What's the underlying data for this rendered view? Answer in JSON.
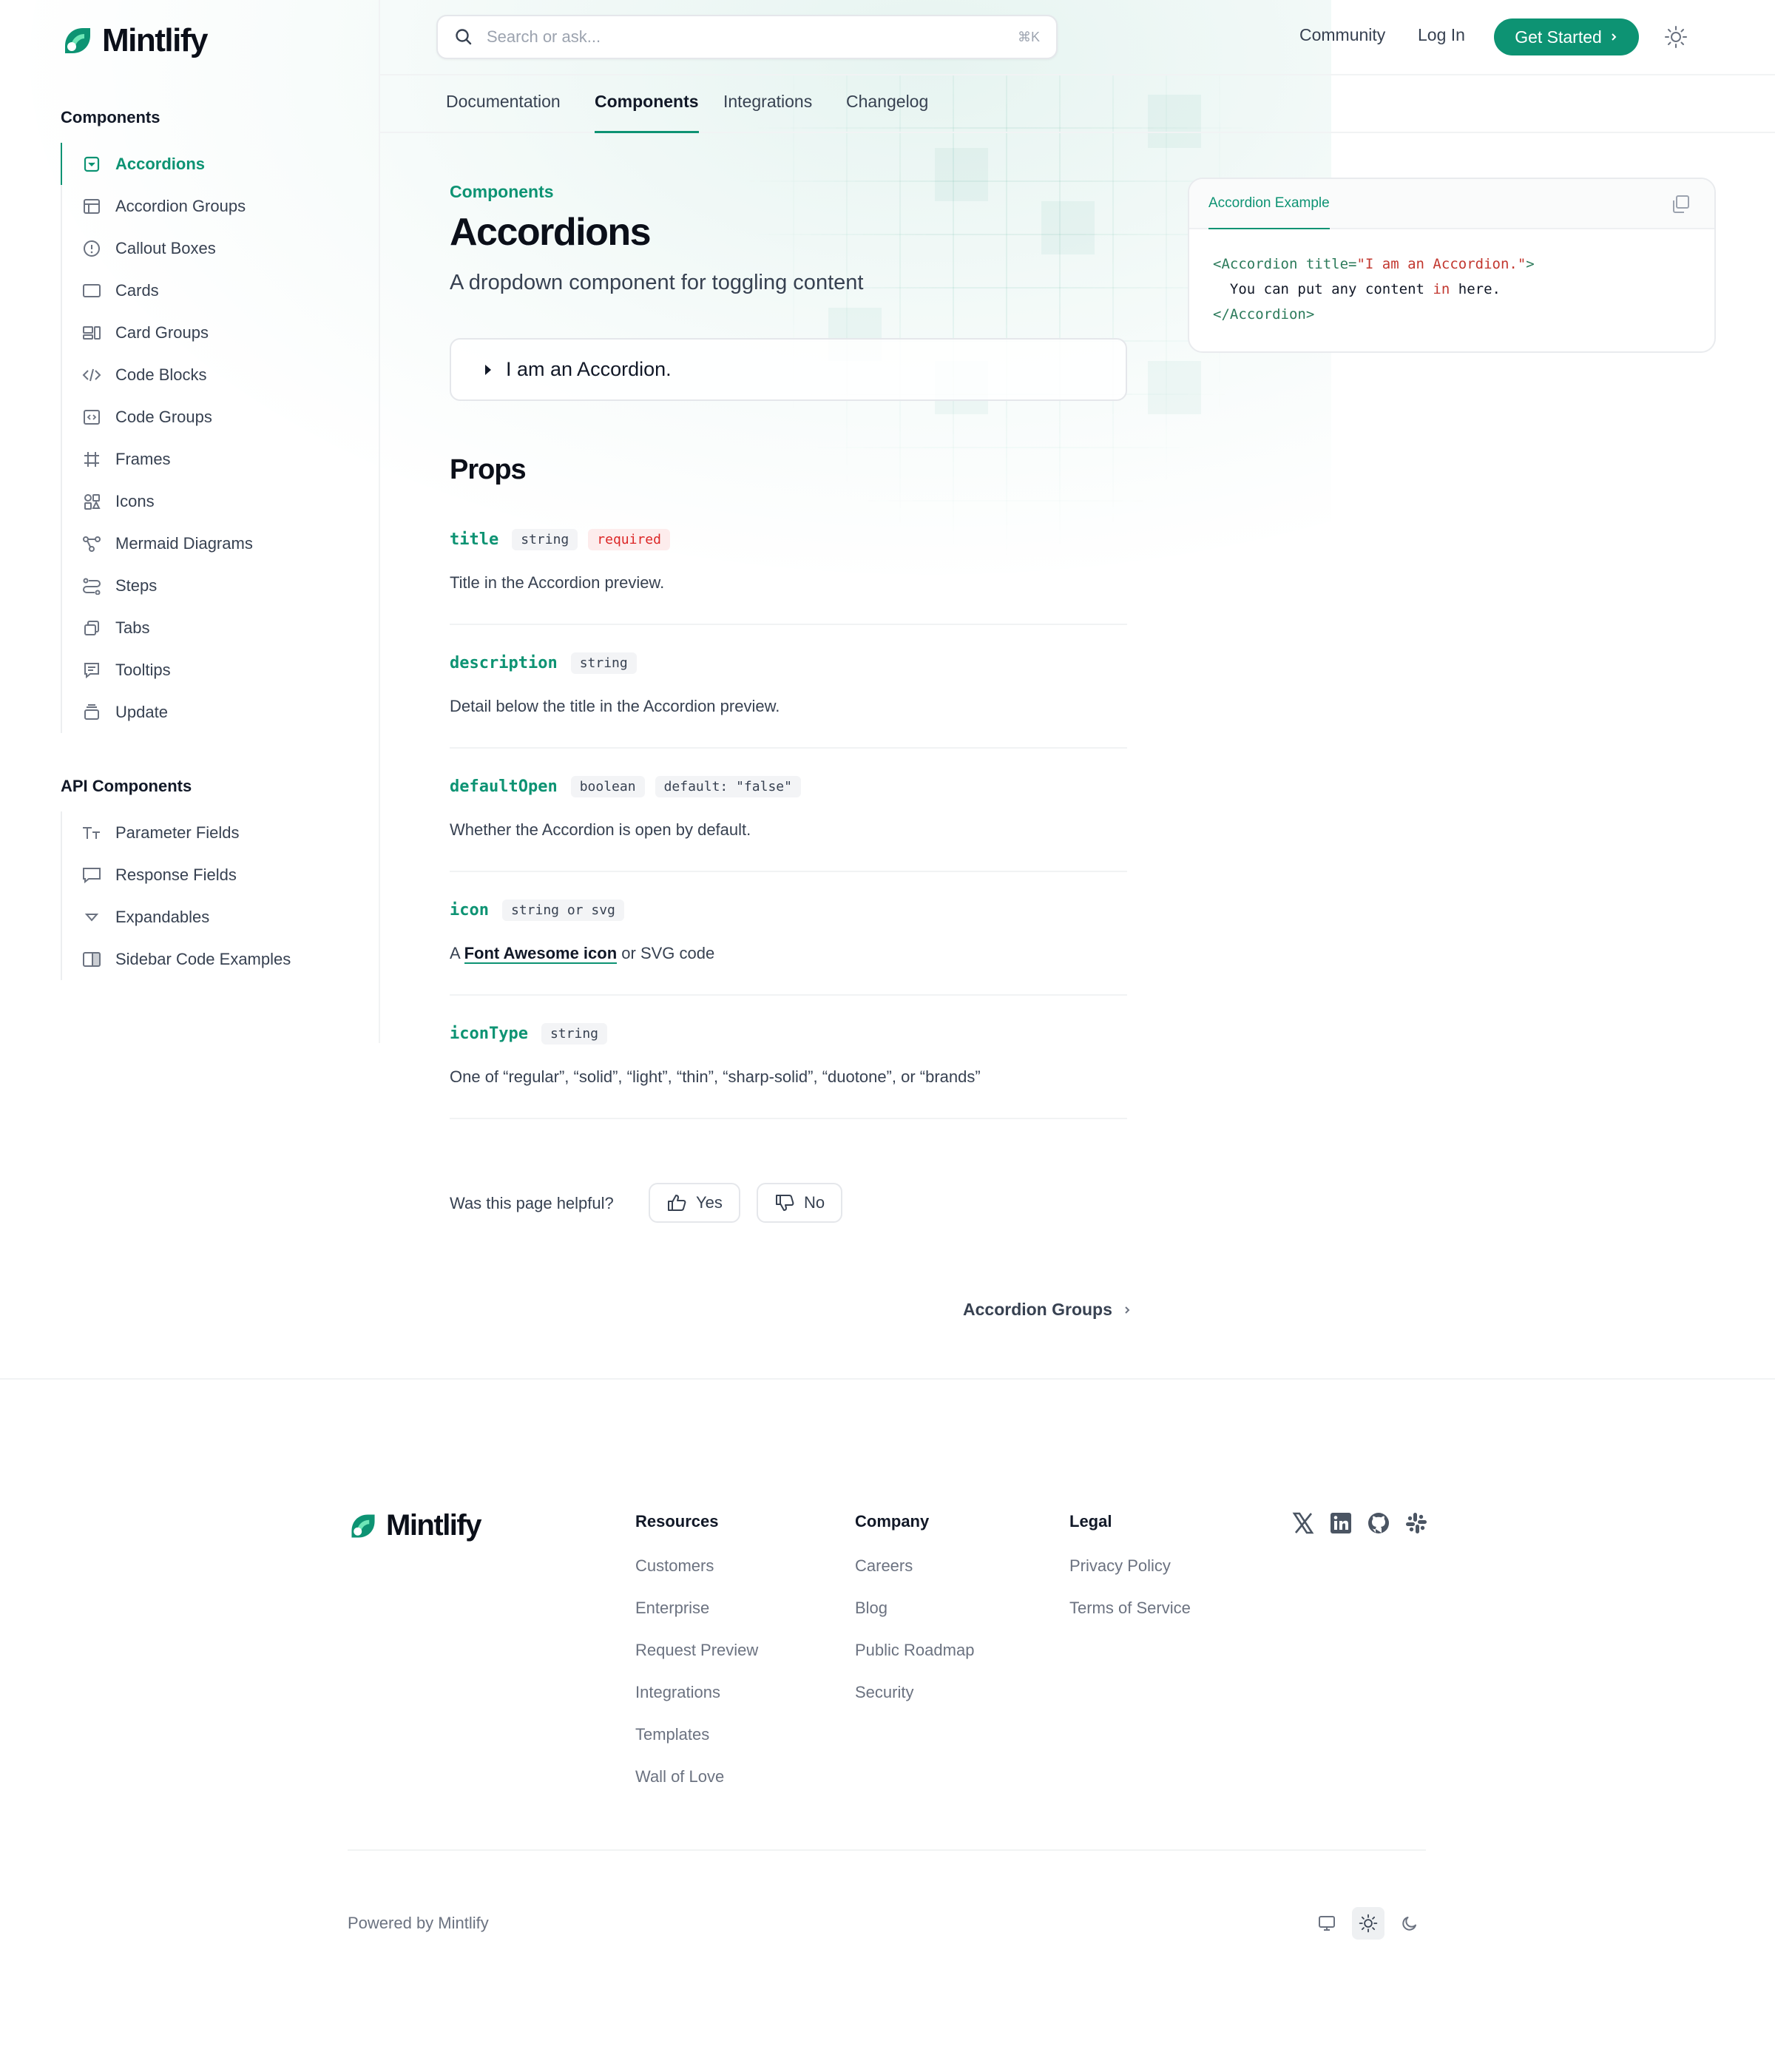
{
  "brand": {
    "name": "Mintlify",
    "accent": "#0d9373"
  },
  "search": {
    "placeholder": "Search or ask...",
    "shortcut": "⌘K"
  },
  "header": {
    "community": "Community",
    "login": "Log In",
    "cta": "Get Started"
  },
  "tabs": [
    {
      "label": "Documentation"
    },
    {
      "label": "Components",
      "active": true
    },
    {
      "label": "Integrations"
    },
    {
      "label": "Changelog"
    }
  ],
  "sidebar": {
    "groups": [
      {
        "title": "Components",
        "items": [
          {
            "label": "Accordions",
            "icon": "accordion-icon",
            "active": true
          },
          {
            "label": "Accordion Groups",
            "icon": "accordion-group-icon"
          },
          {
            "label": "Callout Boxes",
            "icon": "info-circle-icon"
          },
          {
            "label": "Cards",
            "icon": "card-icon"
          },
          {
            "label": "Card Groups",
            "icon": "card-group-icon"
          },
          {
            "label": "Code Blocks",
            "icon": "code-icon"
          },
          {
            "label": "Code Groups",
            "icon": "code-box-icon"
          },
          {
            "label": "Frames",
            "icon": "frame-icon"
          },
          {
            "label": "Icons",
            "icon": "icons-icon"
          },
          {
            "label": "Mermaid Diagrams",
            "icon": "diagram-icon"
          },
          {
            "label": "Steps",
            "icon": "steps-icon"
          },
          {
            "label": "Tabs",
            "icon": "tabs-icon"
          },
          {
            "label": "Tooltips",
            "icon": "tooltip-icon"
          },
          {
            "label": "Update",
            "icon": "layers-icon"
          }
        ]
      },
      {
        "title": "API Components",
        "items": [
          {
            "label": "Parameter Fields",
            "icon": "text-size-icon"
          },
          {
            "label": "Response Fields",
            "icon": "message-icon"
          },
          {
            "label": "Expandables",
            "icon": "triangle-down-icon"
          },
          {
            "label": "Sidebar Code Examples",
            "icon": "sidebar-panel-icon"
          }
        ]
      }
    ]
  },
  "page": {
    "eyebrow": "Components",
    "title": "Accordions",
    "subtitle": "A dropdown component for toggling content",
    "accordion_title": "I am an Accordion.",
    "props_heading": "Props"
  },
  "props": [
    {
      "name": "title",
      "type": "string",
      "badge": "required",
      "description": "Title in the Accordion preview."
    },
    {
      "name": "description",
      "type": "string",
      "description": "Detail below the title in the Accordion preview."
    },
    {
      "name": "defaultOpen",
      "type": "boolean",
      "default": "default: \"false\"",
      "description": "Whether the Accordion is open by default."
    },
    {
      "name": "icon",
      "type": "string or svg",
      "description_pre": "A ",
      "description_link": "Font Awesome icon",
      "description_post": " or SVG code"
    },
    {
      "name": "iconType",
      "type": "string",
      "description": "One of “regular”, “solid”, “light”, “thin”, “sharp-solid”, “duotone”, or “brands”"
    }
  ],
  "code_example": {
    "tab": "Accordion Example",
    "line1_open": "<Accordion ",
    "line1_attr": "title=",
    "line1_str": "\"I am an Accordion.\"",
    "line1_close": ">",
    "line2_a": "  You can put any content ",
    "line2_kw": "in",
    "line2_b": " here.",
    "line3": "</Accordion>"
  },
  "feedback": {
    "question": "Was this page helpful?",
    "yes": "Yes",
    "no": "No"
  },
  "next": {
    "label": "Accordion Groups"
  },
  "footer": {
    "columns": [
      {
        "title": "Resources",
        "links": [
          "Customers",
          "Enterprise",
          "Request Preview",
          "Integrations",
          "Templates",
          "Wall of Love"
        ]
      },
      {
        "title": "Company",
        "links": [
          "Careers",
          "Blog",
          "Public Roadmap",
          "Security"
        ]
      },
      {
        "title": "Legal",
        "links": [
          "Privacy Policy",
          "Terms of Service"
        ]
      }
    ],
    "social": [
      "x-icon",
      "linkedin-icon",
      "github-icon",
      "slack-icon"
    ],
    "powered": "Powered by Mintlify",
    "theme_modes": [
      "monitor-icon",
      "sun-icon",
      "moon-icon"
    ]
  }
}
